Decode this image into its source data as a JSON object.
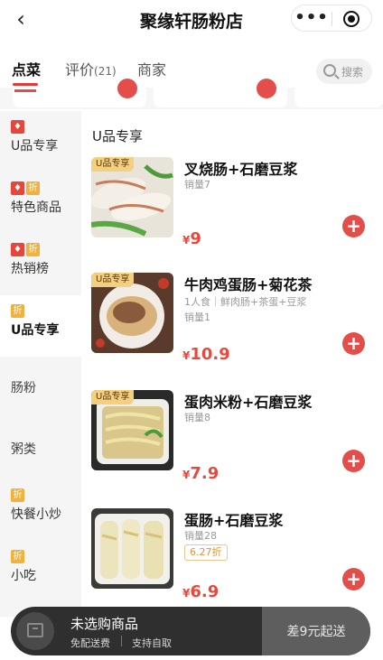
{
  "header": {
    "title": "聚缘轩肠粉店",
    "back_icon": "chevron-left-icon",
    "more_label": "•••"
  },
  "tabs": [
    {
      "label": "点菜"
    },
    {
      "label": "评价",
      "count": "(21)"
    },
    {
      "label": "商家"
    }
  ],
  "search": {
    "placeholder": "搜索"
  },
  "sidebar": {
    "items": [
      {
        "label": "U品专享",
        "badges": [
          "hot"
        ]
      },
      {
        "label": "特色商品",
        "badges": [
          "hot",
          "discount"
        ]
      },
      {
        "label": "热销榜",
        "badges": [
          "hot",
          "discount"
        ]
      },
      {
        "label": "U品专享",
        "badges": [
          "discount"
        ],
        "active": true
      },
      {
        "label": "肠粉",
        "badges": []
      },
      {
        "label": "粥类",
        "badges": []
      },
      {
        "label": "快餐小炒",
        "badges": [
          "discount"
        ]
      },
      {
        "label": "小吃",
        "badges": [
          "discount"
        ]
      }
    ],
    "discount_badge_text": "折"
  },
  "main": {
    "section_title": "U品专享",
    "products": [
      {
        "name": "叉烧肠+石磨豆浆",
        "tag": "U品专享",
        "sales": "销量7",
        "price_symbol": "¥",
        "price": "9"
      },
      {
        "name": "牛肉鸡蛋肠+菊花茶",
        "tag": "U品专享",
        "desc": "1人食｜鲜肉肠+茶蛋+豆浆",
        "sales": "销量1",
        "price_symbol": "¥",
        "price": "10.9"
      },
      {
        "name": "蛋肉米粉+石磨豆浆",
        "tag": "U品专享",
        "sales": "销量8",
        "price_symbol": "¥",
        "price": "7.9"
      },
      {
        "name": "蛋肠+石磨豆浆",
        "sales": "销量28",
        "discount": "6.27折",
        "price_symbol": "¥",
        "price": "6.9"
      }
    ],
    "add_label": "+"
  },
  "cart": {
    "title": "未选购商品",
    "delivery": "免配送费",
    "pickup": "支持自取",
    "minimum": "差9元起送"
  },
  "colors": {
    "accent": "#e34e4b",
    "price": "#e8493f",
    "tag_bg": "#f3cf7e",
    "cart_bg": "#2f2f2f"
  }
}
